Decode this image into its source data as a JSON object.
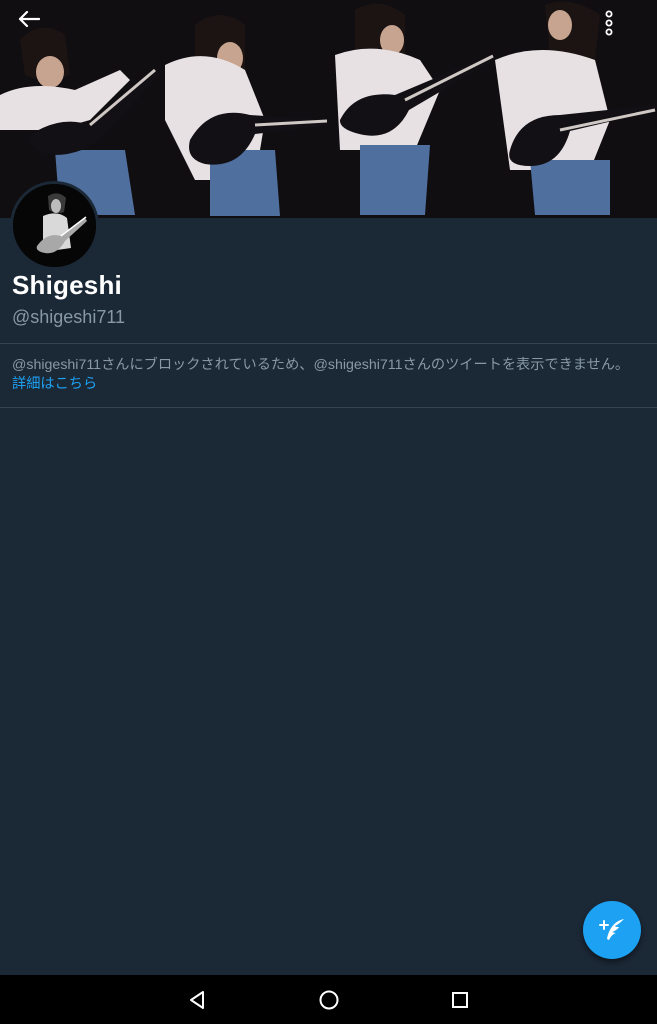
{
  "header": {
    "back_icon": "arrow-left-icon",
    "menu_icon": "more-vertical-icon"
  },
  "profile": {
    "display_name": "Shigeshi",
    "handle": "@shigeshi711"
  },
  "blocked": {
    "message": "@shigeshi711さんにブロックされているため、@shigeshi711さんのツイートを表示できません。",
    "learn_more": "詳細はこちら"
  },
  "fab": {
    "icon": "compose-tweet-icon"
  },
  "navbar": {
    "back_icon": "nav-back-triangle-icon",
    "home_icon": "nav-home-circle-icon",
    "recents_icon": "nav-recents-square-icon"
  },
  "colors": {
    "background": "#1b2836",
    "accent": "#1da1f2",
    "primary_text": "#ffffff",
    "secondary_text": "#8899a6",
    "divider": "#38444d"
  }
}
